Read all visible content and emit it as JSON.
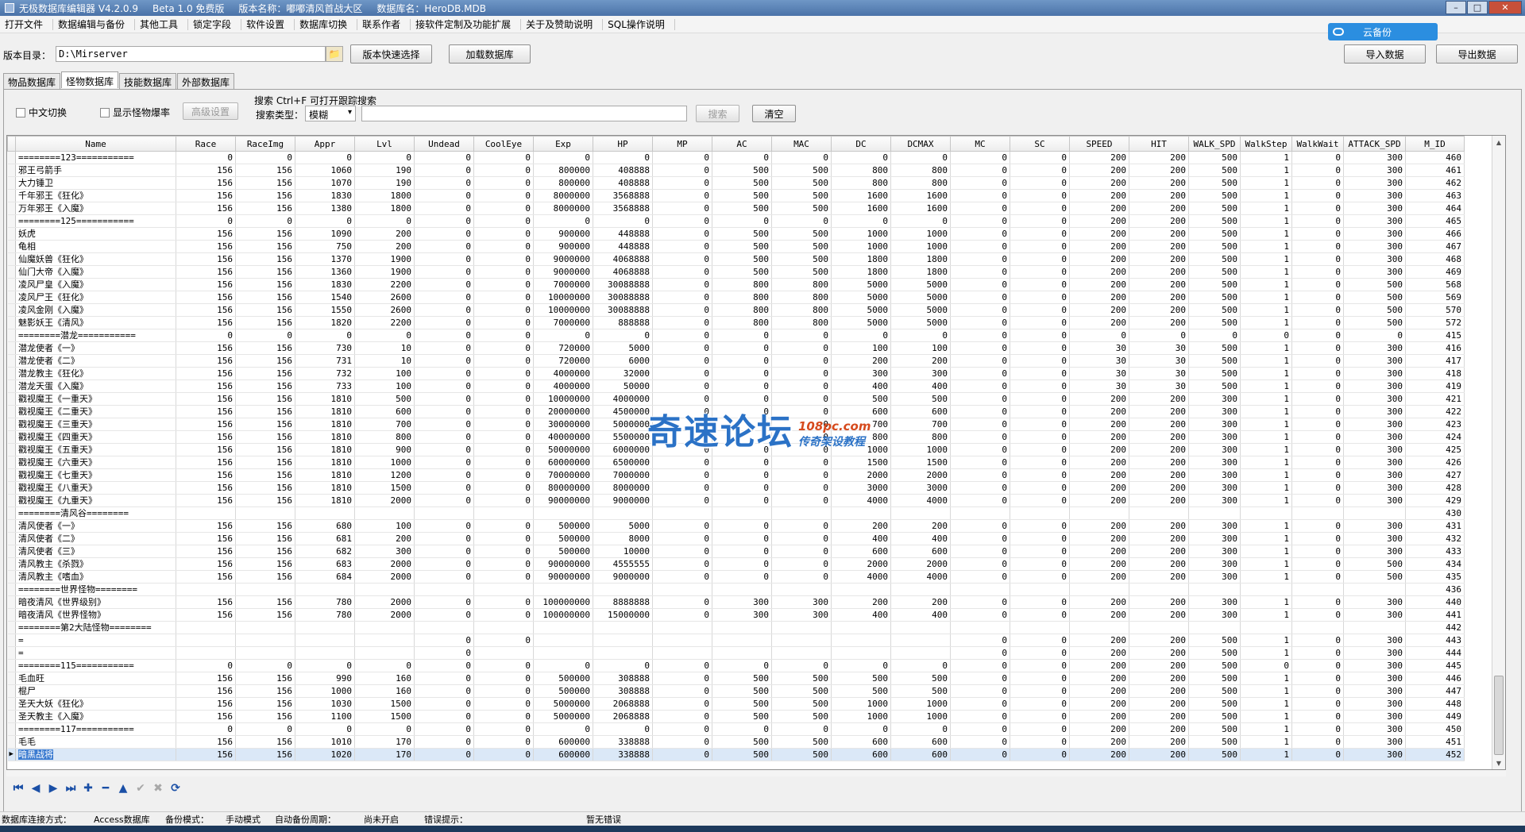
{
  "title": {
    "app": "无极数据库编辑器 V4.2.0.9",
    "edition": "Beta 1.0 免费版",
    "version_name": "版本名称：嘟嘟清风首战大区",
    "db_name": "数据库名：HeroDB.MDB"
  },
  "menu": [
    "打开文件",
    "数据编辑与备份",
    "其他工具",
    "锁定字段",
    "软件设置",
    "数据库切换",
    "联系作者",
    "接软件定制及功能扩展",
    "关于及赞助说明",
    "SQL操作说明"
  ],
  "cloud": {
    "label": "云备份"
  },
  "toolbar": {
    "dir_label": "版本目录：",
    "dir_value": "D:\\Mirserver",
    "quick_select": "版本快速选择",
    "load_db": "加载数据库",
    "import": "导入数据",
    "export": "导出数据"
  },
  "tabs": [
    "物品数据库",
    "怪物数据库",
    "技能数据库",
    "外部数据库"
  ],
  "filters": {
    "chinese_switch": "中文切换",
    "show_drop": "显示怪物爆率",
    "advanced": "高级设置",
    "search_hint": "搜索  Ctrl+F 可打开跟踪搜索",
    "search_type_label": "搜索类型：",
    "search_type": "模糊",
    "search_btn": "搜索",
    "clear_btn": "清空"
  },
  "columns": [
    "Name",
    "Race",
    "RaceImg",
    "Appr",
    "Lvl",
    "Undead",
    "CoolEye",
    "Exp",
    "HP",
    "MP",
    "AC",
    "MAC",
    "DC",
    "DCMAX",
    "MC",
    "SC",
    "SPEED",
    "HIT",
    "WALK_SPD",
    "WalkStep",
    "WalkWait",
    "ATTACK_SPD",
    "M_ID"
  ],
  "rows": [
    [
      "========123===========",
      "0",
      "0",
      "0",
      "0",
      "0",
      "0",
      "0",
      "0",
      "0",
      "0",
      "0",
      "0",
      "0",
      "0",
      "0",
      "200",
      "200",
      "500",
      "1",
      "0",
      "300",
      "460"
    ],
    [
      "邪王弓箭手",
      "156",
      "156",
      "1060",
      "190",
      "0",
      "0",
      "800000",
      "408888",
      "0",
      "500",
      "500",
      "800",
      "800",
      "0",
      "0",
      "200",
      "200",
      "500",
      "1",
      "0",
      "300",
      "461"
    ],
    [
      "大力锤卫",
      "156",
      "156",
      "1070",
      "190",
      "0",
      "0",
      "800000",
      "408888",
      "0",
      "500",
      "500",
      "800",
      "800",
      "0",
      "0",
      "200",
      "200",
      "500",
      "1",
      "0",
      "300",
      "462"
    ],
    [
      "千年邪王《狂化》",
      "156",
      "156",
      "1830",
      "1800",
      "0",
      "0",
      "8000000",
      "3568888",
      "0",
      "500",
      "500",
      "1600",
      "1600",
      "0",
      "0",
      "200",
      "200",
      "500",
      "1",
      "0",
      "300",
      "463"
    ],
    [
      "万年邪王《入魔》",
      "156",
      "156",
      "1380",
      "1800",
      "0",
      "0",
      "8000000",
      "3568888",
      "0",
      "500",
      "500",
      "1600",
      "1600",
      "0",
      "0",
      "200",
      "200",
      "500",
      "1",
      "0",
      "300",
      "464"
    ],
    [
      "========125===========",
      "0",
      "0",
      "0",
      "0",
      "0",
      "0",
      "0",
      "0",
      "0",
      "0",
      "0",
      "0",
      "0",
      "0",
      "0",
      "200",
      "200",
      "500",
      "1",
      "0",
      "300",
      "465"
    ],
    [
      "妖虎",
      "156",
      "156",
      "1090",
      "200",
      "0",
      "0",
      "900000",
      "448888",
      "0",
      "500",
      "500",
      "1000",
      "1000",
      "0",
      "0",
      "200",
      "200",
      "500",
      "1",
      "0",
      "300",
      "466"
    ],
    [
      "龟相",
      "156",
      "156",
      "750",
      "200",
      "0",
      "0",
      "900000",
      "448888",
      "0",
      "500",
      "500",
      "1000",
      "1000",
      "0",
      "0",
      "200",
      "200",
      "500",
      "1",
      "0",
      "300",
      "467"
    ],
    [
      "仙魔妖兽《狂化》",
      "156",
      "156",
      "1370",
      "1900",
      "0",
      "0",
      "9000000",
      "4068888",
      "0",
      "500",
      "500",
      "1800",
      "1800",
      "0",
      "0",
      "200",
      "200",
      "500",
      "1",
      "0",
      "300",
      "468"
    ],
    [
      "仙门大帝《入魔》",
      "156",
      "156",
      "1360",
      "1900",
      "0",
      "0",
      "9000000",
      "4068888",
      "0",
      "500",
      "500",
      "1800",
      "1800",
      "0",
      "0",
      "200",
      "200",
      "500",
      "1",
      "0",
      "300",
      "469"
    ],
    [
      "凌风尸皇《入魔》",
      "156",
      "156",
      "1830",
      "2200",
      "0",
      "0",
      "7000000",
      "30088888",
      "0",
      "800",
      "800",
      "5000",
      "5000",
      "0",
      "0",
      "200",
      "200",
      "500",
      "1",
      "0",
      "500",
      "568"
    ],
    [
      "凌风尸王《狂化》",
      "156",
      "156",
      "1540",
      "2600",
      "0",
      "0",
      "10000000",
      "30088888",
      "0",
      "800",
      "800",
      "5000",
      "5000",
      "0",
      "0",
      "200",
      "200",
      "500",
      "1",
      "0",
      "500",
      "569"
    ],
    [
      "凌风金刚《入魔》",
      "156",
      "156",
      "1550",
      "2600",
      "0",
      "0",
      "10000000",
      "30088888",
      "0",
      "800",
      "800",
      "5000",
      "5000",
      "0",
      "0",
      "200",
      "200",
      "500",
      "1",
      "0",
      "500",
      "570"
    ],
    [
      "魅影妖王《清风》",
      "156",
      "156",
      "1820",
      "2200",
      "0",
      "0",
      "7000000",
      "888888",
      "0",
      "800",
      "800",
      "5000",
      "5000",
      "0",
      "0",
      "200",
      "200",
      "500",
      "1",
      "0",
      "500",
      "572"
    ],
    [
      "========潜龙===========",
      "0",
      "0",
      "0",
      "0",
      "0",
      "0",
      "0",
      "0",
      "0",
      "0",
      "0",
      "0",
      "0",
      "0",
      "0",
      "0",
      "0",
      "0",
      "0",
      "0",
      "0",
      "415"
    ],
    [
      "潜龙使者《一》",
      "156",
      "156",
      "730",
      "10",
      "0",
      "0",
      "720000",
      "5000",
      "0",
      "0",
      "0",
      "100",
      "100",
      "0",
      "0",
      "30",
      "30",
      "500",
      "1",
      "0",
      "300",
      "416"
    ],
    [
      "潜龙使者《二》",
      "156",
      "156",
      "731",
      "10",
      "0",
      "0",
      "720000",
      "6000",
      "0",
      "0",
      "0",
      "200",
      "200",
      "0",
      "0",
      "30",
      "30",
      "500",
      "1",
      "0",
      "300",
      "417"
    ],
    [
      "潜龙教主《狂化》",
      "156",
      "156",
      "732",
      "100",
      "0",
      "0",
      "4000000",
      "32000",
      "0",
      "0",
      "0",
      "300",
      "300",
      "0",
      "0",
      "30",
      "30",
      "500",
      "1",
      "0",
      "300",
      "418"
    ],
    [
      "潜龙天蛋《入魔》",
      "156",
      "156",
      "733",
      "100",
      "0",
      "0",
      "4000000",
      "50000",
      "0",
      "0",
      "0",
      "400",
      "400",
      "0",
      "0",
      "30",
      "30",
      "500",
      "1",
      "0",
      "300",
      "419"
    ],
    [
      "戳视魔王《一重天》",
      "156",
      "156",
      "1810",
      "500",
      "0",
      "0",
      "10000000",
      "4000000",
      "0",
      "0",
      "0",
      "500",
      "500",
      "0",
      "0",
      "200",
      "200",
      "300",
      "1",
      "0",
      "300",
      "421"
    ],
    [
      "戳视魔王《二重天》",
      "156",
      "156",
      "1810",
      "600",
      "0",
      "0",
      "20000000",
      "4500000",
      "0",
      "0",
      "0",
      "600",
      "600",
      "0",
      "0",
      "200",
      "200",
      "300",
      "1",
      "0",
      "300",
      "422"
    ],
    [
      "戳视魔王《三重天》",
      "156",
      "156",
      "1810",
      "700",
      "0",
      "0",
      "30000000",
      "5000000",
      "0",
      "0",
      "0",
      "700",
      "700",
      "0",
      "0",
      "200",
      "200",
      "300",
      "1",
      "0",
      "300",
      "423"
    ],
    [
      "戳视魔王《四重天》",
      "156",
      "156",
      "1810",
      "800",
      "0",
      "0",
      "40000000",
      "5500000",
      "0",
      "0",
      "0",
      "800",
      "800",
      "0",
      "0",
      "200",
      "200",
      "300",
      "1",
      "0",
      "300",
      "424"
    ],
    [
      "戳视魔王《五重天》",
      "156",
      "156",
      "1810",
      "900",
      "0",
      "0",
      "50000000",
      "6000000",
      "0",
      "0",
      "0",
      "1000",
      "1000",
      "0",
      "0",
      "200",
      "200",
      "300",
      "1",
      "0",
      "300",
      "425"
    ],
    [
      "戳视魔王《六重天》",
      "156",
      "156",
      "1810",
      "1000",
      "0",
      "0",
      "60000000",
      "6500000",
      "0",
      "0",
      "0",
      "1500",
      "1500",
      "0",
      "0",
      "200",
      "200",
      "300",
      "1",
      "0",
      "300",
      "426"
    ],
    [
      "戳视魔王《七重天》",
      "156",
      "156",
      "1810",
      "1200",
      "0",
      "0",
      "70000000",
      "7000000",
      "0",
      "0",
      "0",
      "2000",
      "2000",
      "0",
      "0",
      "200",
      "200",
      "300",
      "1",
      "0",
      "300",
      "427"
    ],
    [
      "戳视魔王《八重天》",
      "156",
      "156",
      "1810",
      "1500",
      "0",
      "0",
      "80000000",
      "8000000",
      "0",
      "0",
      "0",
      "3000",
      "3000",
      "0",
      "0",
      "200",
      "200",
      "300",
      "1",
      "0",
      "300",
      "428"
    ],
    [
      "戳视魔王《九重天》",
      "156",
      "156",
      "1810",
      "2000",
      "0",
      "0",
      "90000000",
      "9000000",
      "0",
      "0",
      "0",
      "4000",
      "4000",
      "0",
      "0",
      "200",
      "200",
      "300",
      "1",
      "0",
      "300",
      "429"
    ],
    [
      "========清风谷========",
      "",
      "",
      "",
      "",
      "",
      "",
      "",
      "",
      "",
      "",
      "",
      "",
      "",
      "",
      "",
      "",
      "",
      "",
      "",
      "",
      "",
      "430"
    ],
    [
      "清风使者《一》",
      "156",
      "156",
      "680",
      "100",
      "0",
      "0",
      "500000",
      "5000",
      "0",
      "0",
      "0",
      "200",
      "200",
      "0",
      "0",
      "200",
      "200",
      "300",
      "1",
      "0",
      "300",
      "431"
    ],
    [
      "清风使者《二》",
      "156",
      "156",
      "681",
      "200",
      "0",
      "0",
      "500000",
      "8000",
      "0",
      "0",
      "0",
      "400",
      "400",
      "0",
      "0",
      "200",
      "200",
      "300",
      "1",
      "0",
      "300",
      "432"
    ],
    [
      "清风使者《三》",
      "156",
      "156",
      "682",
      "300",
      "0",
      "0",
      "500000",
      "10000",
      "0",
      "0",
      "0",
      "600",
      "600",
      "0",
      "0",
      "200",
      "200",
      "300",
      "1",
      "0",
      "300",
      "433"
    ],
    [
      "清风教主《杀戮》",
      "156",
      "156",
      "683",
      "2000",
      "0",
      "0",
      "90000000",
      "4555555",
      "0",
      "0",
      "0",
      "2000",
      "2000",
      "0",
      "0",
      "200",
      "200",
      "300",
      "1",
      "0",
      "500",
      "434"
    ],
    [
      "清风教主《嗜血》",
      "156",
      "156",
      "684",
      "2000",
      "0",
      "0",
      "90000000",
      "9000000",
      "0",
      "0",
      "0",
      "4000",
      "4000",
      "0",
      "0",
      "200",
      "200",
      "300",
      "1",
      "0",
      "500",
      "435"
    ],
    [
      "========世界怪物========",
      "",
      "",
      "",
      "",
      "",
      "",
      "",
      "",
      "",
      "",
      "",
      "",
      "",
      "",
      "",
      "",
      "",
      "",
      "",
      "",
      "",
      "436"
    ],
    [
      "暗夜清风《世界级别》",
      "156",
      "156",
      "780",
      "2000",
      "0",
      "0",
      "100000000",
      "8888888",
      "0",
      "300",
      "300",
      "200",
      "200",
      "0",
      "0",
      "200",
      "200",
      "300",
      "1",
      "0",
      "300",
      "440"
    ],
    [
      "暗夜清风《世界怪物》",
      "156",
      "156",
      "780",
      "2000",
      "0",
      "0",
      "100000000",
      "15000000",
      "0",
      "300",
      "300",
      "400",
      "400",
      "0",
      "0",
      "200",
      "200",
      "300",
      "1",
      "0",
      "300",
      "441"
    ],
    [
      "========第2大陆怪物========",
      "",
      "",
      "",
      "",
      "",
      "",
      "",
      "",
      "",
      "",
      "",
      "",
      "",
      "",
      "",
      "",
      "",
      "",
      "",
      "",
      "",
      "442"
    ],
    [
      "=",
      "",
      "",
      "",
      "",
      "0",
      "0",
      "",
      "",
      "",
      "",
      "",
      "",
      "",
      "0",
      "0",
      "200",
      "200",
      "500",
      "1",
      "0",
      "300",
      "443"
    ],
    [
      "=",
      "",
      "",
      "",
      "",
      "0",
      "",
      "",
      "",
      "",
      "",
      "",
      "",
      "",
      "0",
      "0",
      "200",
      "200",
      "500",
      "1",
      "0",
      "300",
      "444"
    ],
    [
      "========115===========",
      "0",
      "0",
      "0",
      "0",
      "0",
      "0",
      "0",
      "0",
      "0",
      "0",
      "0",
      "0",
      "0",
      "0",
      "0",
      "200",
      "200",
      "500",
      "0",
      "0",
      "300",
      "445"
    ],
    [
      "毛血旺",
      "156",
      "156",
      "990",
      "160",
      "0",
      "0",
      "500000",
      "308888",
      "0",
      "500",
      "500",
      "500",
      "500",
      "0",
      "0",
      "200",
      "200",
      "500",
      "1",
      "0",
      "300",
      "446"
    ],
    [
      "棍尸",
      "156",
      "156",
      "1000",
      "160",
      "0",
      "0",
      "500000",
      "308888",
      "0",
      "500",
      "500",
      "500",
      "500",
      "0",
      "0",
      "200",
      "200",
      "500",
      "1",
      "0",
      "300",
      "447"
    ],
    [
      "圣天大妖《狂化》",
      "156",
      "156",
      "1030",
      "1500",
      "0",
      "0",
      "5000000",
      "2068888",
      "0",
      "500",
      "500",
      "1000",
      "1000",
      "0",
      "0",
      "200",
      "200",
      "500",
      "1",
      "0",
      "300",
      "448"
    ],
    [
      "圣天教主《入魔》",
      "156",
      "156",
      "1100",
      "1500",
      "0",
      "0",
      "5000000",
      "2068888",
      "0",
      "500",
      "500",
      "1000",
      "1000",
      "0",
      "0",
      "200",
      "200",
      "500",
      "1",
      "0",
      "300",
      "449"
    ],
    [
      "========117===========",
      "0",
      "0",
      "0",
      "0",
      "0",
      "0",
      "0",
      "0",
      "0",
      "0",
      "0",
      "0",
      "0",
      "0",
      "0",
      "200",
      "200",
      "500",
      "1",
      "0",
      "300",
      "450"
    ],
    [
      "毛毛",
      "156",
      "156",
      "1010",
      "170",
      "0",
      "0",
      "600000",
      "338888",
      "0",
      "500",
      "500",
      "600",
      "600",
      "0",
      "0",
      "200",
      "200",
      "500",
      "1",
      "0",
      "300",
      "451"
    ],
    [
      "暗黑战将",
      "156",
      "156",
      "1020",
      "170",
      "0",
      "0",
      "600000",
      "338888",
      "0",
      "500",
      "500",
      "600",
      "600",
      "0",
      "0",
      "200",
      "200",
      "500",
      "1",
      "0",
      "300",
      "452"
    ]
  ],
  "selected_row": 47,
  "nav": [
    "first",
    "prev",
    "next",
    "last",
    "add",
    "delete",
    "up",
    "confirm",
    "cancel",
    "refresh"
  ],
  "watermark": {
    "main": "奇速论坛",
    "url": "108pc.com",
    "sub": "传奇架设教程"
  },
  "status": {
    "conn_label": "数据库连接方式：",
    "conn_value": "Access数据库",
    "backup_label": "备份模式：",
    "backup_value": "手动模式",
    "auto_label": "自动备份周期：",
    "auto_value": "尚未开启",
    "err_label": "错误提示：",
    "err_value": "暂无错误"
  },
  "colors": {
    "title": "#4a72a8",
    "accent": "#2b8ee0",
    "selected": "#3b7bd0",
    "watermark": "#2b72c6"
  }
}
